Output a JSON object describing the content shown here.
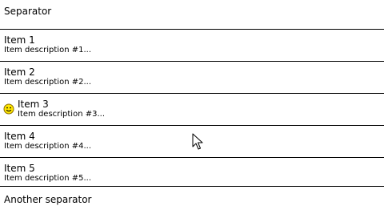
{
  "list": {
    "separator_top": "Separator",
    "separator_bottom": "Another separator",
    "items": [
      {
        "title": "Item 1",
        "description": "Item description #1..."
      },
      {
        "title": "Item 2",
        "description": "Item description #2..."
      },
      {
        "title": "Item 3",
        "description": "Item description #3...",
        "icon": "smiley-icon"
      },
      {
        "title": "Item 4",
        "description": "Item description #4..."
      },
      {
        "title": "Item 5",
        "description": "Item description #5..."
      }
    ]
  },
  "colors": {
    "background": "#ffffff",
    "text": "#000000",
    "rule": "#000000",
    "smiley_fill": "#ffe600",
    "smiley_outline": "#8a6d00"
  },
  "pointer": {
    "icon": "arrow-cursor-icon"
  }
}
